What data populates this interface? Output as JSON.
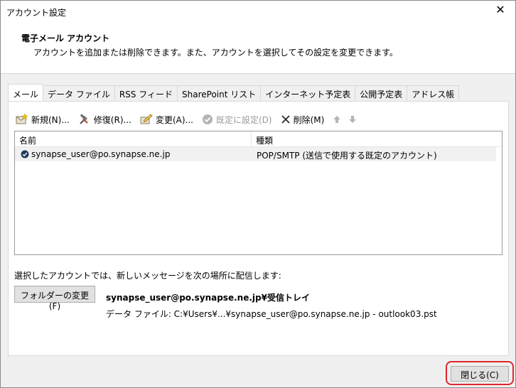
{
  "window": {
    "title": "アカウント設定",
    "close_glyph": "✕"
  },
  "header": {
    "title": "電子メール アカウント",
    "description": "アカウントを追加または削除できます。また、アカウントを選択してその設定を変更できます。"
  },
  "tabs": [
    {
      "label": "メール",
      "active": true
    },
    {
      "label": "データ ファイル"
    },
    {
      "label": "RSS フィード"
    },
    {
      "label": "SharePoint リスト"
    },
    {
      "label": "インターネット予定表"
    },
    {
      "label": "公開予定表"
    },
    {
      "label": "アドレス帳"
    }
  ],
  "toolbar": {
    "new": "新規(N)...",
    "repair": "修復(R)...",
    "change": "変更(A)...",
    "set_default": "既定に設定(D)",
    "delete": "削除(M)"
  },
  "list": {
    "columns": {
      "name": "名前",
      "type": "種類"
    },
    "rows": [
      {
        "name": "synapse_user@po.synapse.ne.jp",
        "type": "POP/SMTP (送信で使用する既定のアカウント)"
      }
    ]
  },
  "delivery": {
    "label": "選択したアカウントでは、新しいメッセージを次の場所に配信します:",
    "change_folder_button": "フォルダーの変更(F)",
    "folder_path": "synapse_user@po.synapse.ne.jp¥受信トレイ",
    "data_file": "データ ファイル: C:¥Users¥...¥synapse_user@po.synapse.ne.jp - outlook03.pst"
  },
  "footer": {
    "close_button": "閉じる(C)"
  },
  "colors": {
    "highlight_border": "#e0262e",
    "disabled_text": "#9a9a9a"
  }
}
